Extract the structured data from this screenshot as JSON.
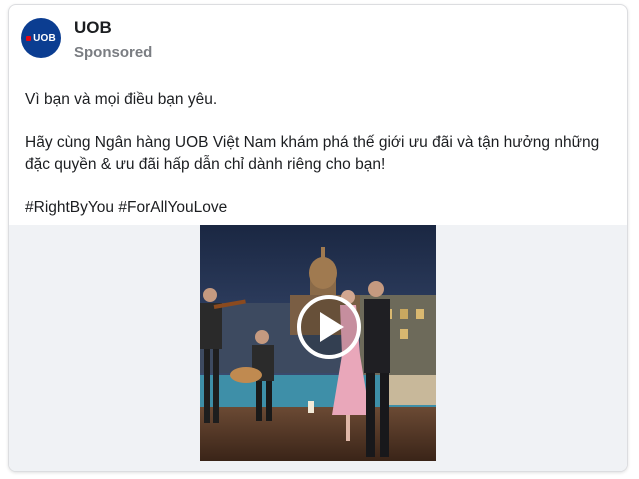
{
  "post": {
    "page_name": "UOB",
    "sponsored_label": "Sponsored",
    "avatar": {
      "logo_text": "UOB",
      "brand_color": "#0b3d91",
      "mark_color": "#e30613"
    },
    "caption": {
      "line1": "Vì bạn và mọi điều bạn yêu.",
      "line2": "Hãy cùng Ngân hàng UOB Việt Nam khám phá thế giới ưu đãi và tận hưởng những đặc quyền & ưu đãi hấp dẫn chỉ dành riêng cho bạn!",
      "hashtags": "#RightByYou #ForAllYouLove"
    },
    "video": {
      "thumbnail": "rooftop-violinist-guitarist-dancing-couple-night",
      "play_icon": "play-icon"
    }
  }
}
